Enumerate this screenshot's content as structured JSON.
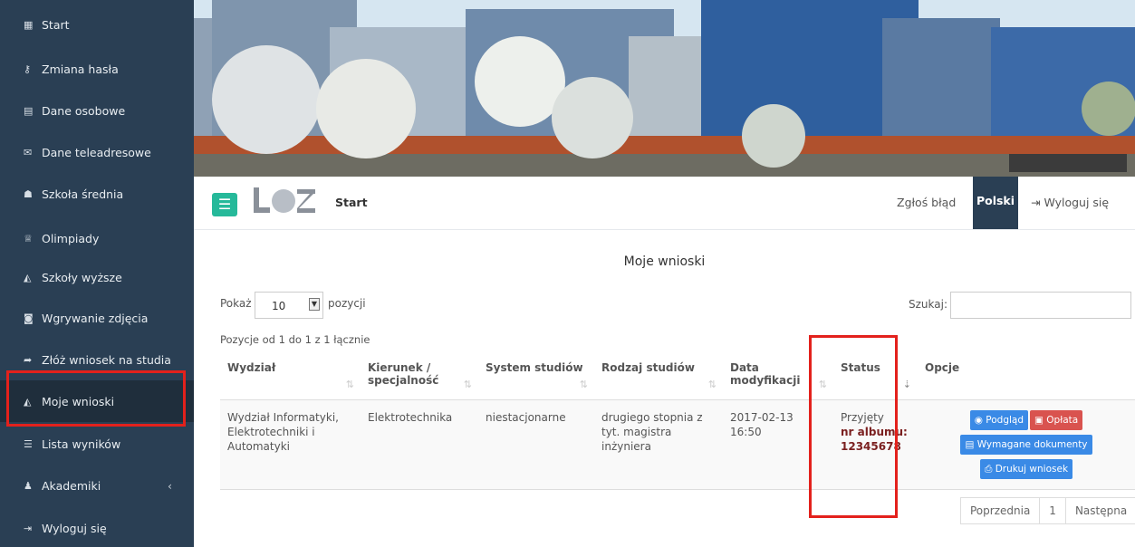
{
  "sidebar": {
    "items": [
      {
        "label": "Start",
        "icon": "grid-icon"
      },
      {
        "label": "Zmiana hasła",
        "icon": "key-icon"
      },
      {
        "label": "Dane osobowe",
        "icon": "id-card-icon"
      },
      {
        "label": "Dane teleadresowe",
        "icon": "envelope-icon"
      },
      {
        "label": "Szkoła średnia",
        "icon": "users-icon"
      },
      {
        "label": "Olimpiady",
        "icon": "trophy-icon"
      },
      {
        "label": "Szkoły wyższe",
        "icon": "graduation-cap-icon"
      },
      {
        "label": "Wgrywanie zdjęcia",
        "icon": "camera-icon"
      },
      {
        "label": "Złóż wniosek na studia",
        "icon": "share-icon"
      },
      {
        "label": "Moje wnioski",
        "icon": "graduation-cap-icon"
      },
      {
        "label": "Lista wyników",
        "icon": "list-icon"
      },
      {
        "label": "Akademiki",
        "icon": "person-icon"
      },
      {
        "label": "Wyloguj się",
        "icon": "sign-out-icon"
      }
    ],
    "akademiki_chevron": "‹"
  },
  "topnav": {
    "brand": "Start",
    "report_bug": "Zgłoś błąd",
    "language": "Polski",
    "logout": "Wyloguj się"
  },
  "main": {
    "title": "Moje wnioski",
    "show_label": "Pokaż",
    "show_value": "10",
    "show_after": "pozycji",
    "search_label": "Szukaj:",
    "info": "Pozycje od 1 do 1 z 1 łącznie"
  },
  "table": {
    "headers": [
      "Wydział",
      "Kierunek / specjalność",
      "System studiów",
      "Rodzaj studiów",
      "Data modyfikacji",
      "Status",
      "Opcje"
    ],
    "rows": [
      {
        "wydzial": "Wydział Informatyki, Elektrotechniki i Automatyki",
        "kierunek": "Elektrotechnika",
        "system": "niestacjonarne",
        "rodzaj": "drugiego stopnia z tyt. magistra inżyniera",
        "data": "2017-02-13 16:50",
        "status": "Przyjęty",
        "album_label": "nr albumu:",
        "album_number": "12345678",
        "buttons": {
          "preview": "Podgląd",
          "payment": "Opłata",
          "documents": "Wymagane dokumenty",
          "print": "Drukuj wniosek"
        }
      }
    ]
  },
  "pagination": {
    "previous": "Poprzednia",
    "page": "1",
    "next": "Następna"
  },
  "colors": {
    "sidebar": "#2a3f54",
    "accent_green": "#26b99a",
    "button_blue": "#3a8ae6",
    "button_red": "#d9534f",
    "highlight": "#e3211c"
  }
}
